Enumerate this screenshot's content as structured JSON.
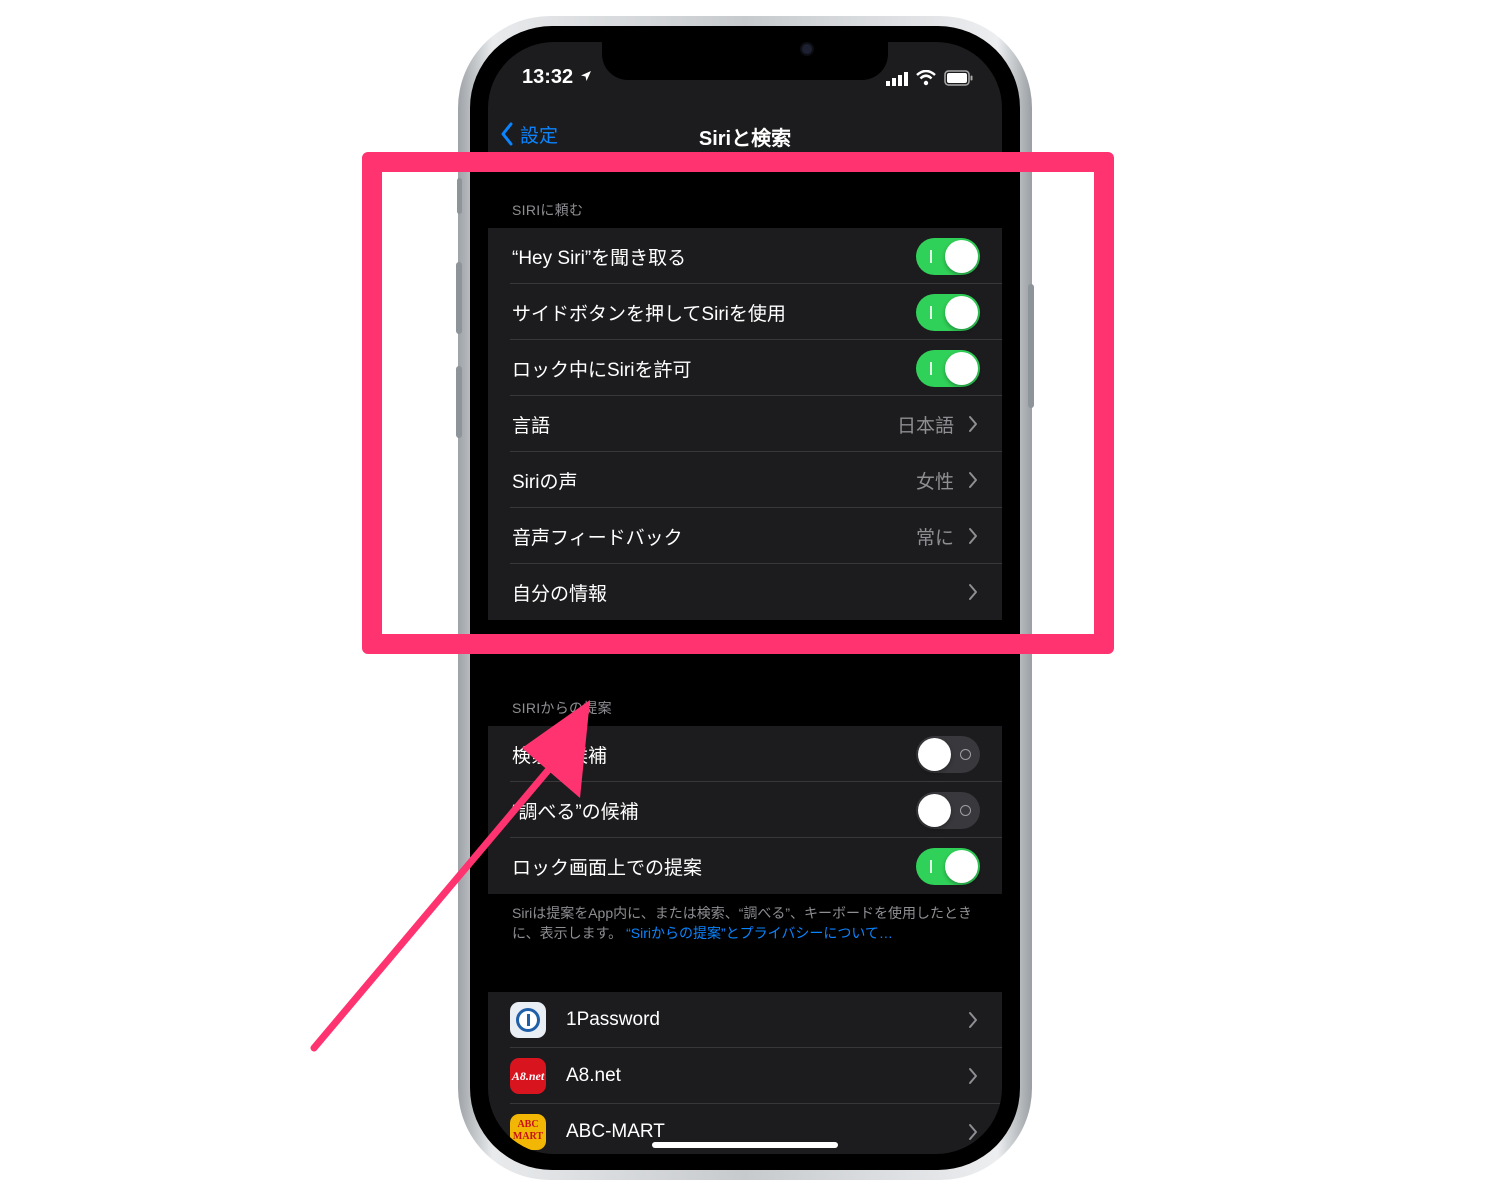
{
  "status_bar": {
    "time": "13:32",
    "icons": [
      "location-icon",
      "signal-icon",
      "wifi-icon",
      "battery-icon"
    ]
  },
  "nav": {
    "back_label": "設定",
    "title": "Siriと検索"
  },
  "sections": {
    "ask_siri": {
      "header": "SIRIに頼む",
      "rows": [
        {
          "label": "“Hey Siri”を聞き取る",
          "toggle": true
        },
        {
          "label": "サイドボタンを押してSiriを使用",
          "toggle": true
        },
        {
          "label": "ロック中にSiriを許可",
          "toggle": true
        },
        {
          "label": "言語",
          "value": "日本語"
        },
        {
          "label": "Siriの声",
          "value": "女性"
        },
        {
          "label": "音声フィードバック",
          "value": "常に"
        },
        {
          "label": "自分の情報",
          "value": ""
        }
      ],
      "footnote_link": "プライバシーについて…"
    },
    "suggestions": {
      "header": "SIRIからの提案",
      "rows": [
        {
          "label": "検索の候補",
          "toggle": false
        },
        {
          "label": "“調べる”の候補",
          "toggle": false
        },
        {
          "label": "ロック画面上での提案",
          "toggle": true
        }
      ],
      "footnote_text": "Siriは提案をApp内に、または検索、“調べる”、キーボードを使用したときに、表示します。",
      "footnote_link": "“Siriからの提案”とプライバシーについて…"
    },
    "apps": [
      {
        "name": "1Password",
        "icon": "1password-icon"
      },
      {
        "name": "A8.net",
        "icon": "a8net-icon",
        "icon_text": "A8.net"
      },
      {
        "name": "ABC-MART",
        "icon": "abcmart-icon",
        "icon_text": "ABC MART"
      }
    ]
  },
  "colors": {
    "highlight": "#ff3370",
    "toggle_on": "#30d158",
    "toggle_off": "#39393d",
    "link": "#0a84ff",
    "cell_bg": "#1c1c1e",
    "screen_bg": "#000000"
  }
}
